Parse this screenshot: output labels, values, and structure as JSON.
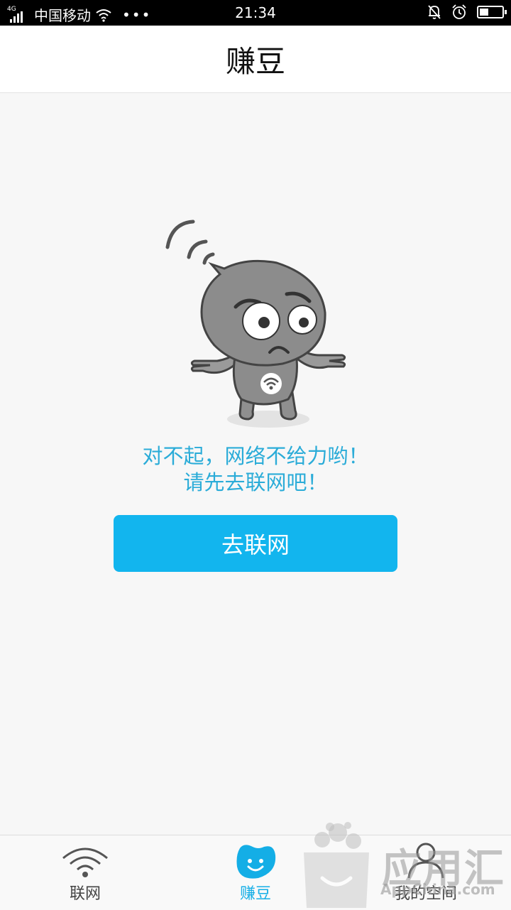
{
  "status_bar": {
    "network": "4G",
    "carrier": "中国移动",
    "dots": "•••",
    "time": "21:34"
  },
  "header": {
    "title": "赚豆"
  },
  "error": {
    "line1": "对不起，网络不给力哟！",
    "line2": "请先去联网吧！"
  },
  "connect_button": {
    "label": "去联网"
  },
  "tabs": [
    {
      "label": "联网",
      "icon": "wifi-icon",
      "active": false
    },
    {
      "label": "赚豆",
      "icon": "bean-icon",
      "active": true
    },
    {
      "label": "我的空间",
      "icon": "person-icon",
      "active": false
    }
  ],
  "watermark": {
    "text": "应用汇",
    "url": "AppChina.com"
  },
  "colors": {
    "accent": "#12b5ee",
    "message": "#2bacd8",
    "mascot": "#8c8c8c"
  }
}
